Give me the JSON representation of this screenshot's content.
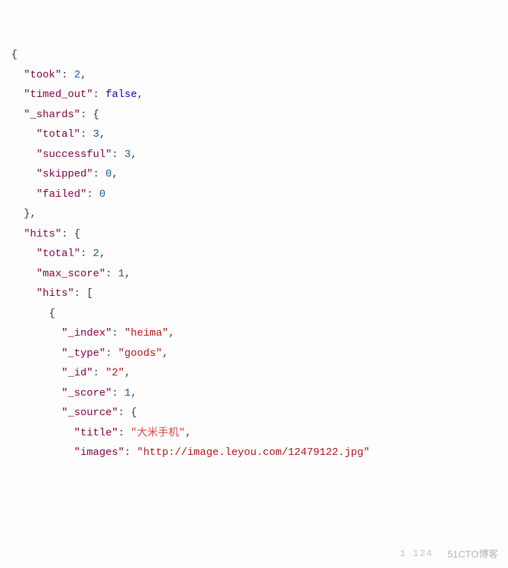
{
  "json": {
    "took": 2,
    "timed_out": "false",
    "_shards": {
      "total": 3,
      "successful": 3,
      "skipped": 0,
      "failed": 0
    },
    "hits": {
      "total": 2,
      "max_score": 1,
      "hits_arr": [
        {
          "_index": "heima",
          "_type": "goods",
          "_id": "2",
          "_score": 1,
          "_source": {
            "title": "大米手机",
            "images": "http://image.leyou.com/12479122.jpg"
          }
        }
      ]
    }
  },
  "keys": {
    "took": "\"took\"",
    "timed_out": "\"timed_out\"",
    "_shards": "\"_shards\"",
    "total": "\"total\"",
    "successful": "\"successful\"",
    "skipped": "\"skipped\"",
    "failed": "\"failed\"",
    "hits": "\"hits\"",
    "max_score": "\"max_score\"",
    "_index": "\"_index\"",
    "_type": "\"_type\"",
    "_id": "\"_id\"",
    "_score": "\"_score\"",
    "_source": "\"_source\"",
    "title": "\"title\"",
    "images": "\"images\""
  },
  "strv": {
    "_index": "\"heima\"",
    "_type": "\"goods\"",
    "_id": "\"2\"",
    "title": "\"大米手机\"",
    "images": "\"http://image.leyou.com/12479122.jpg\""
  },
  "watermark": "51CTO博客",
  "hintnum": "1 124"
}
